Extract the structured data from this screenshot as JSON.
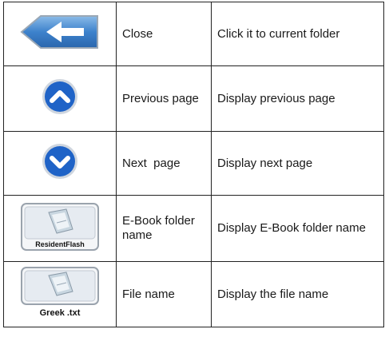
{
  "rows": [
    {
      "icon": "back-arrow-icon",
      "name": "Close",
      "description": "Click it to current folder"
    },
    {
      "icon": "chevron-up-icon",
      "name": "Previous page",
      "description": "Display previous page"
    },
    {
      "icon": "chevron-down-icon",
      "name": "Next  page",
      "description": "Display next page"
    },
    {
      "icon": "ebook-folder-icon",
      "icon_label": "ResidentFlash",
      "name": "E-Book folder name",
      "description": "Display E-Book folder name"
    },
    {
      "icon": "file-icon",
      "icon_label": "Greek .txt",
      "name": "File name",
      "description": "Display the file name"
    }
  ],
  "colors": {
    "button_blue": "#1f63c7",
    "back_button_blue": "#3f82c9",
    "border": "#222222"
  }
}
